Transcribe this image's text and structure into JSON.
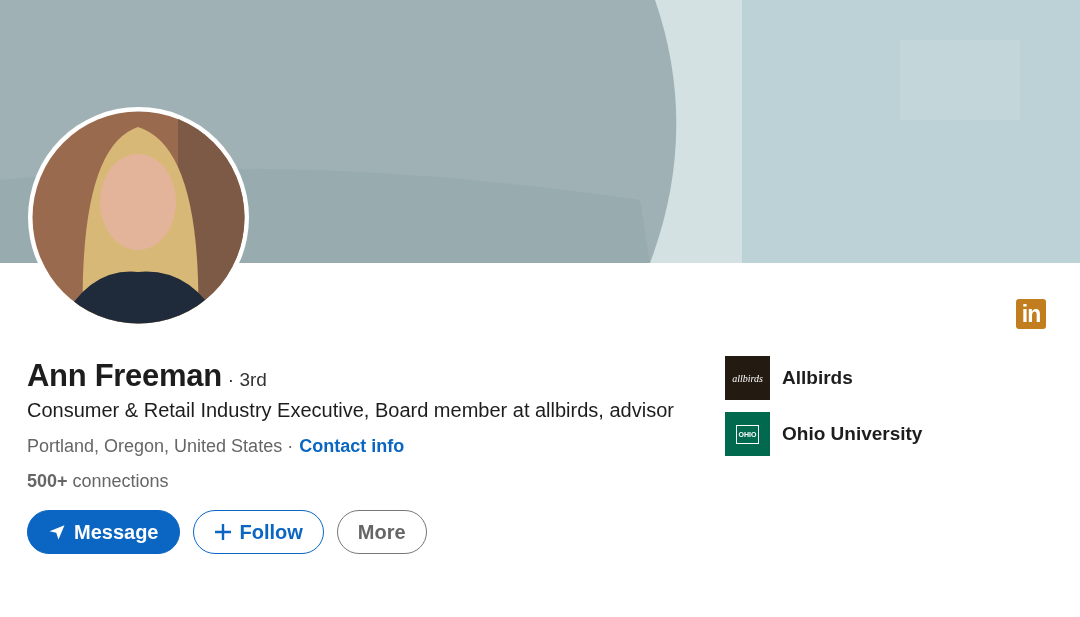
{
  "brand_badge": "in",
  "profile": {
    "name": "Ann Freeman",
    "degree": "· 3rd",
    "headline": "Consumer & Retail Industry Executive, Board member at allbirds, advisor",
    "location": "Portland, Oregon, United States ·",
    "contact_link": "Contact info",
    "connections": "**500+** connections"
  },
  "actions": [
    {
      "label": "Message",
      "kind": "primary"
    },
    {
      "label": "Follow",
      "kind": "secondary"
    },
    {
      "label": "More",
      "kind": "neutral"
    }
  ],
  "affiliations": [
    {
      "name": "Allbirds",
      "logo_text": "allbirds",
      "kind": "company"
    },
    {
      "name": "Ohio University",
      "logo_text": "OHIO",
      "kind": "school"
    }
  ]
}
